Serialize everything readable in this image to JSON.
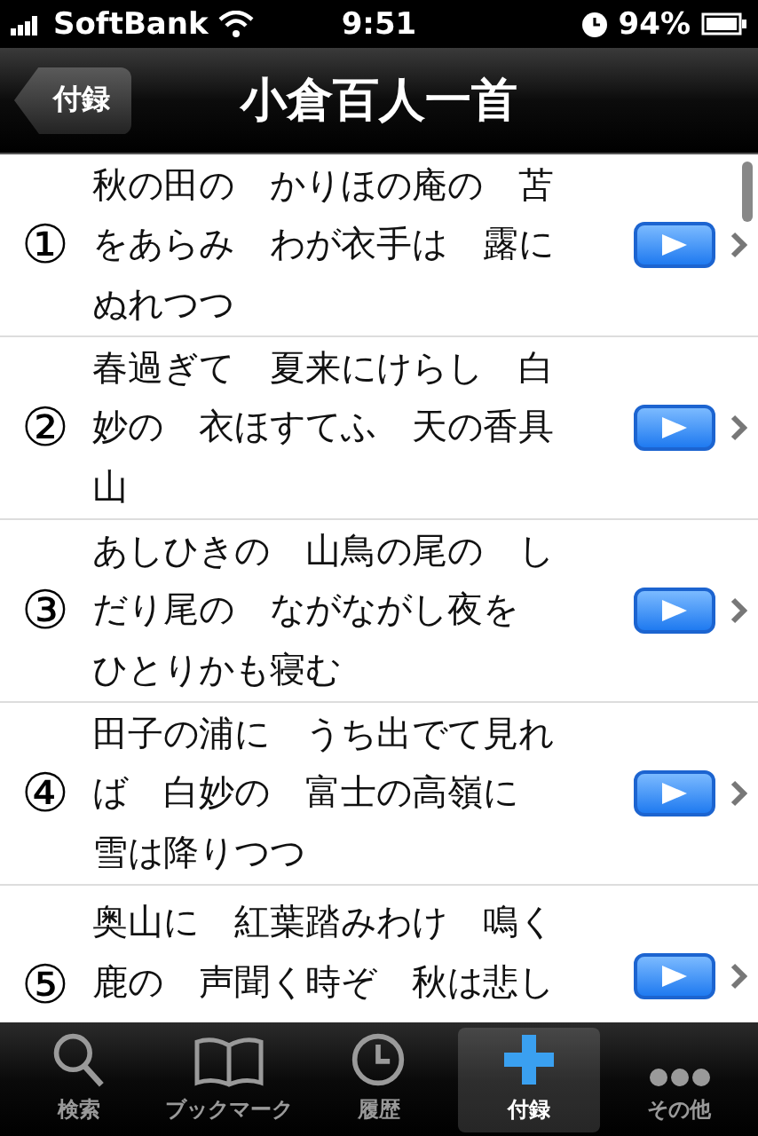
{
  "status_bar": {
    "carrier": "SoftBank",
    "time": "9:51",
    "battery": "94%"
  },
  "nav_bar": {
    "back": "付録",
    "title": "小倉百人一首"
  },
  "poems": [
    {
      "number": "①",
      "lines": [
        "秋の田の　かりほの庵の　苫",
        "をあらみ　わが衣手は　露に",
        "ぬれつつ"
      ]
    },
    {
      "number": "②",
      "lines": [
        "春過ぎて　夏来にけらし　白",
        "妙の　衣ほすてふ　天の香具",
        "山"
      ]
    },
    {
      "number": "③",
      "lines": [
        "あしひきの　山鳥の尾の　し",
        "だり尾の　ながながし夜を",
        "ひとりかも寝む"
      ]
    },
    {
      "number": "④",
      "lines": [
        "田子の浦に　うち出でて見れ",
        "ば　白妙の　富士の高嶺に",
        "雪は降りつつ"
      ]
    },
    {
      "number": "⑤",
      "lines": [
        "奥山に　紅葉踏みわけ　鳴く",
        "鹿の　声聞く時ぞ　秋は悲し"
      ]
    }
  ],
  "tabs": [
    {
      "kind": "search",
      "label": "検索",
      "selected": false
    },
    {
      "kind": "book",
      "label": "ブックマーク",
      "selected": false
    },
    {
      "kind": "clock",
      "label": "履歴",
      "selected": false
    },
    {
      "kind": "plus",
      "label": "付録",
      "selected": true
    },
    {
      "kind": "more",
      "label": "その他",
      "selected": false
    }
  ]
}
